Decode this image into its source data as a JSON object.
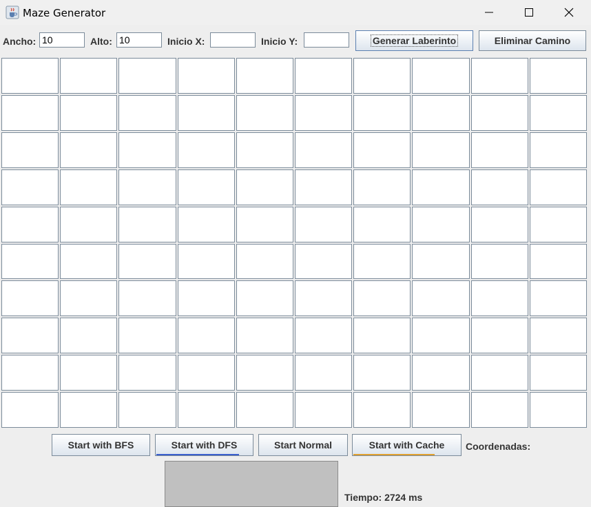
{
  "window": {
    "title": "Maze Generator",
    "icons": {
      "app": "java-cup-icon",
      "minimize": "minimize-icon",
      "maximize": "maximize-icon",
      "close": "close-icon"
    }
  },
  "toolbar": {
    "ancho_label": "Ancho:",
    "ancho_value": "10",
    "alto_label": "Alto:",
    "alto_value": "10",
    "inicio_x_label": "Inicio X:",
    "inicio_x_value": "",
    "inicio_y_label": "Inicio Y:",
    "inicio_y_value": "",
    "generate_label": "Generar Laberinto",
    "remove_path_label": "Eliminar Camino"
  },
  "maze": {
    "rows": 10,
    "cols": 10
  },
  "bottom": {
    "bfs_label": "Start with BFS",
    "dfs_label": "Start with DFS",
    "normal_label": "Start Normal",
    "cache_label": "Start with Cache",
    "coordinates_label": "Coordenadas:",
    "time_text": "Tiempo: 2724 ms"
  },
  "colors": {
    "cell_border": "#7a8a99",
    "focus_blue": "#3a5fcd",
    "progress_orange": "#e0a030",
    "panel_gray": "#c0c0c0"
  }
}
